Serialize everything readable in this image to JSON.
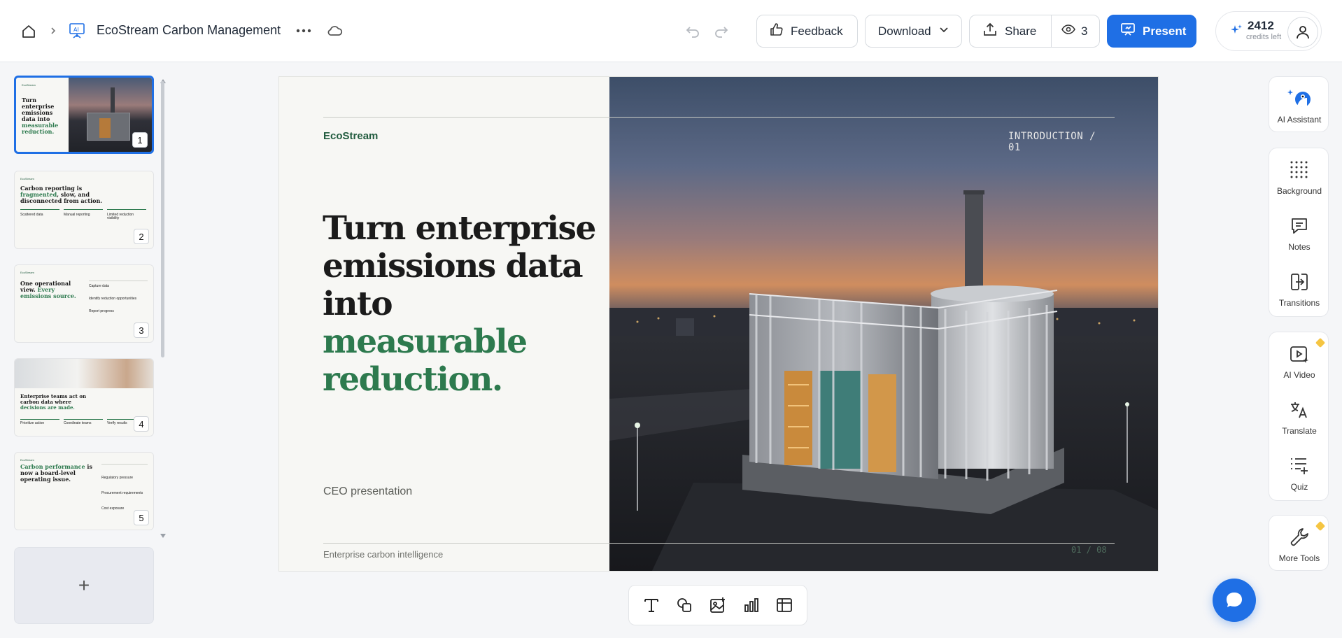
{
  "topbar": {
    "doc_title": "EcoStream Carbon Management",
    "feedback_label": "Feedback",
    "download_label": "Download",
    "share_label": "Share",
    "viewers_count": "3",
    "present_label": "Present",
    "credits_value": "2412",
    "credits_label": "credits left"
  },
  "thumbnails": [
    {
      "number": "1",
      "title_a": "Turn enterprise emissions data into ",
      "title_b": "measurable reduction."
    },
    {
      "number": "2",
      "title_a": "Carbon reporting is ",
      "title_b": "fragmented",
      "title_c": ", slow, and disconnected from action.",
      "cols": [
        "Scattered data",
        "Manual reporting",
        "Limited reduction visibility"
      ]
    },
    {
      "number": "3",
      "title_a": "One operational view. ",
      "title_b": "Every emissions source.",
      "items": [
        "Capture data",
        "Identify reduction opportunities",
        "Report progress"
      ]
    },
    {
      "number": "4",
      "title_a": "Enterprise teams act on carbon data where ",
      "title_b": "decisions are made.",
      "cols": [
        "Prioritize action",
        "Coordinate teams",
        "Verify results"
      ]
    },
    {
      "number": "5",
      "title_a": "Carbon performance",
      "title_b": " is now a board-level operating issue.",
      "items": [
        "Regulatory pressure",
        "Procurement requirements",
        "Cost exposure"
      ]
    }
  ],
  "add_slide_label": "+",
  "slide": {
    "brand": "EcoStream",
    "headline_line1": "Turn enterprise",
    "headline_line2": "emissions data",
    "headline_line3_a": "into ",
    "headline_line3_b": "measurable",
    "headline_line4": "reduction.",
    "subtitle": "CEO presentation",
    "footer": "Enterprise carbon intelligence",
    "section_label": "INTRODUCTION / 01",
    "page_label": "01 / 08"
  },
  "right_panel": {
    "ai_assistant": "AI Assistant",
    "background": "Background",
    "notes": "Notes",
    "transitions": "Transitions",
    "ai_video": "AI Video",
    "translate": "Translate",
    "quiz": "Quiz",
    "more_tools": "More Tools"
  },
  "colors": {
    "accent": "#1f6fe5",
    "slide_green": "#2d7a4e",
    "brand_green": "#225c3f",
    "premium_gem": "#f5c542"
  }
}
